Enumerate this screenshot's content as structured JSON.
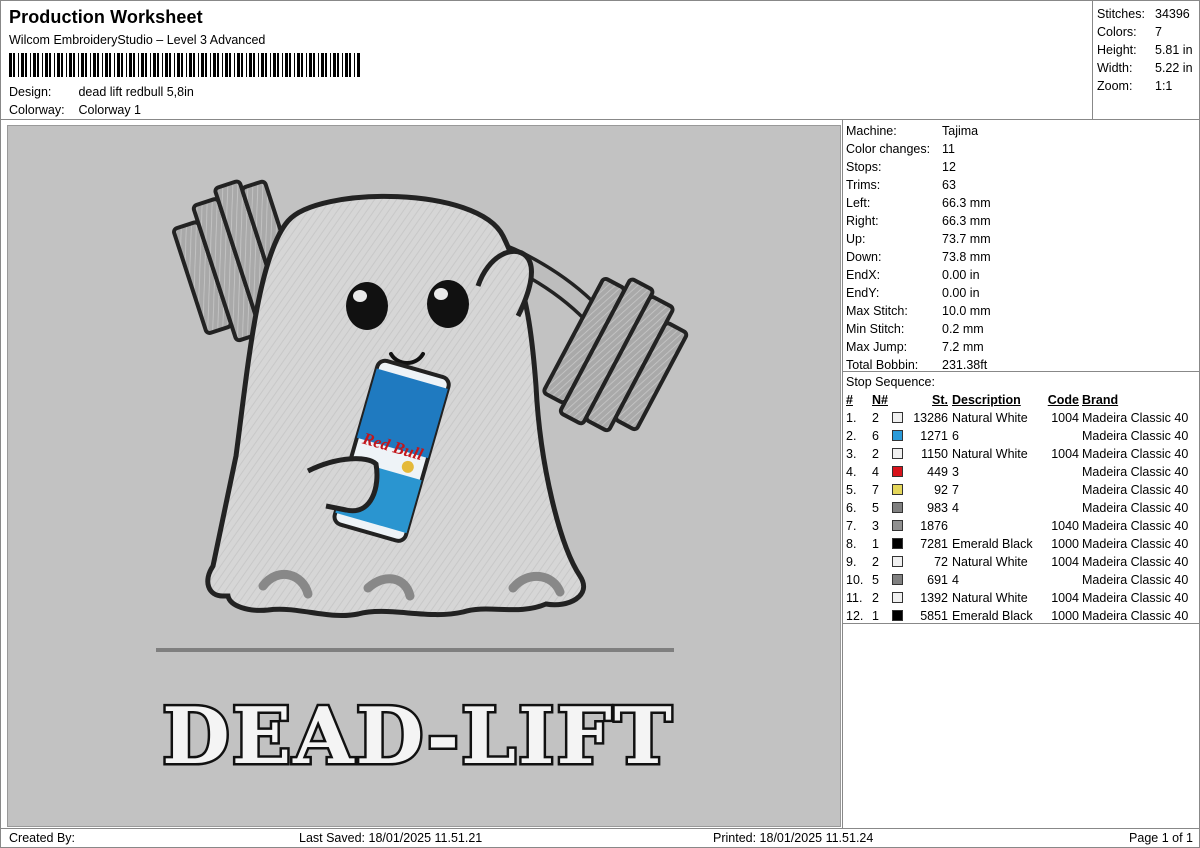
{
  "header": {
    "title": "Production Worksheet",
    "subtitle": "Wilcom EmbroideryStudio – Level 3 Advanced",
    "design_label": "Design:",
    "design_value": "dead lift redbull 5,8in",
    "colorway_label": "Colorway:",
    "colorway_value": "Colorway 1"
  },
  "stats": [
    {
      "label": "Stitches:",
      "value": "34396"
    },
    {
      "label": "Colors:",
      "value": "7"
    },
    {
      "label": "Height:",
      "value": "5.81 in"
    },
    {
      "label": "Width:",
      "value": "5.22 in"
    },
    {
      "label": "Zoom:",
      "value": "1:1"
    }
  ],
  "machine": [
    {
      "label": "Machine:",
      "value": "Tajima"
    },
    {
      "label": "Color changes:",
      "value": "11"
    },
    {
      "label": "Stops:",
      "value": "12"
    },
    {
      "label": "Trims:",
      "value": "63"
    },
    {
      "label": "Left:",
      "value": "66.3 mm"
    },
    {
      "label": "Right:",
      "value": "66.3 mm"
    },
    {
      "label": "Up:",
      "value": "73.7 mm"
    },
    {
      "label": "Down:",
      "value": "73.8 mm"
    },
    {
      "label": "EndX:",
      "value": "0.00 in"
    },
    {
      "label": "EndY:",
      "value": "0.00 in"
    },
    {
      "label": "Max Stitch:",
      "value": "10.0 mm"
    },
    {
      "label": "Min Stitch:",
      "value": "0.2 mm"
    },
    {
      "label": "Max Jump:",
      "value": "7.2 mm"
    },
    {
      "label": "Total Bobbin:",
      "value": "231.38ft"
    }
  ],
  "stop_sequence": {
    "title": "Stop Sequence:",
    "columns": {
      "idx": "#",
      "n": "N#",
      "st": "St.",
      "desc": "Description",
      "code": "Code",
      "brand": "Brand"
    },
    "rows": [
      {
        "idx": "1.",
        "n": "2",
        "color": "#f0f0f0",
        "st": "13286",
        "desc": "Natural White",
        "code": "1004",
        "brand": "Madeira Classic 40"
      },
      {
        "idx": "2.",
        "n": "6",
        "color": "#2a9ad8",
        "st": "1271",
        "desc": "6",
        "code": "",
        "brand": "Madeira Classic 40"
      },
      {
        "idx": "3.",
        "n": "2",
        "color": "#f0f0f0",
        "st": "1150",
        "desc": "Natural White",
        "code": "1004",
        "brand": "Madeira Classic 40"
      },
      {
        "idx": "4.",
        "n": "4",
        "color": "#d8131b",
        "st": "449",
        "desc": "3",
        "code": "",
        "brand": "Madeira Classic 40"
      },
      {
        "idx": "5.",
        "n": "7",
        "color": "#e4d65a",
        "st": "92",
        "desc": "7",
        "code": "",
        "brand": "Madeira Classic 40"
      },
      {
        "idx": "6.",
        "n": "5",
        "color": "#808080",
        "st": "983",
        "desc": "4",
        "code": "",
        "brand": "Madeira Classic 40"
      },
      {
        "idx": "7.",
        "n": "3",
        "color": "#909090",
        "st": "1876",
        "desc": "",
        "code": "1040",
        "brand": "Madeira Classic 40"
      },
      {
        "idx": "8.",
        "n": "1",
        "color": "#000000",
        "st": "7281",
        "desc": "Emerald Black",
        "code": "1000",
        "brand": "Madeira Classic 40"
      },
      {
        "idx": "9.",
        "n": "2",
        "color": "#f0f0f0",
        "st": "72",
        "desc": "Natural White",
        "code": "1004",
        "brand": "Madeira Classic 40"
      },
      {
        "idx": "10.",
        "n": "5",
        "color": "#808080",
        "st": "691",
        "desc": "4",
        "code": "",
        "brand": "Madeira Classic 40"
      },
      {
        "idx": "11.",
        "n": "2",
        "color": "#f0f0f0",
        "st": "1392",
        "desc": "Natural White",
        "code": "1004",
        "brand": "Madeira Classic 40"
      },
      {
        "idx": "12.",
        "n": "1",
        "color": "#000000",
        "st": "5851",
        "desc": "Emerald Black",
        "code": "1000",
        "brand": "Madeira Classic 40"
      }
    ]
  },
  "artwork": {
    "text": "DEAD-LIFT",
    "can_text": "Red Bull"
  },
  "footer": {
    "created_by": "Created By:",
    "last_saved": "Last Saved: 18/01/2025 11.51.21",
    "printed": "Printed: 18/01/2025 11.51.24",
    "page": "Page 1 of 1"
  }
}
